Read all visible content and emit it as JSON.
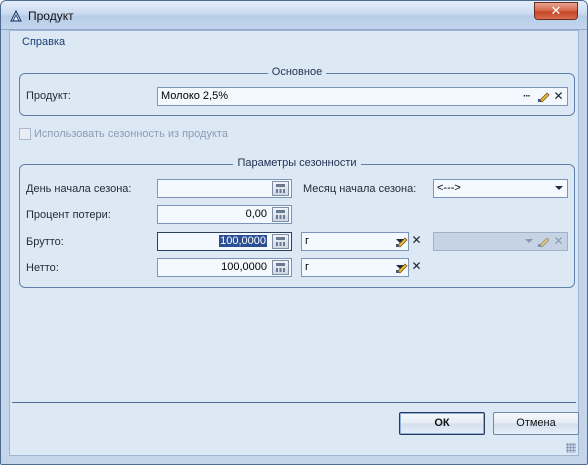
{
  "window": {
    "title": "Продукт",
    "close_glyph": "✕"
  },
  "menu": {
    "help": "Справка"
  },
  "main_group": {
    "legend": "Основное",
    "product_label": "Продукт:",
    "product_value": "Молоко 2,5%",
    "more_glyph": "···",
    "clear_glyph": "✕"
  },
  "season_checkbox": {
    "label": "Использовать сезонность из продукта",
    "checked": false
  },
  "season_group": {
    "legend": "Параметры сезонности",
    "day_start_label": "День начала сезона:",
    "day_start_value": "",
    "month_start_label": "Месяц начала сезона:",
    "month_start_value": "<--->",
    "loss_label": "Процент потери:",
    "loss_value": "0,00",
    "gross_label": "Брутто:",
    "gross_value": "100,0000",
    "gross_unit": "г",
    "gross_extra_value": "",
    "net_label": "Нетто:",
    "net_value": "100,0000",
    "net_unit": "г",
    "clear_glyph": "✕"
  },
  "buttons": {
    "ok": "ОК",
    "cancel": "Отмена"
  },
  "colors": {
    "accent": "#2b4f94",
    "panel": "#dde8f5",
    "border": "#5f80ac"
  }
}
